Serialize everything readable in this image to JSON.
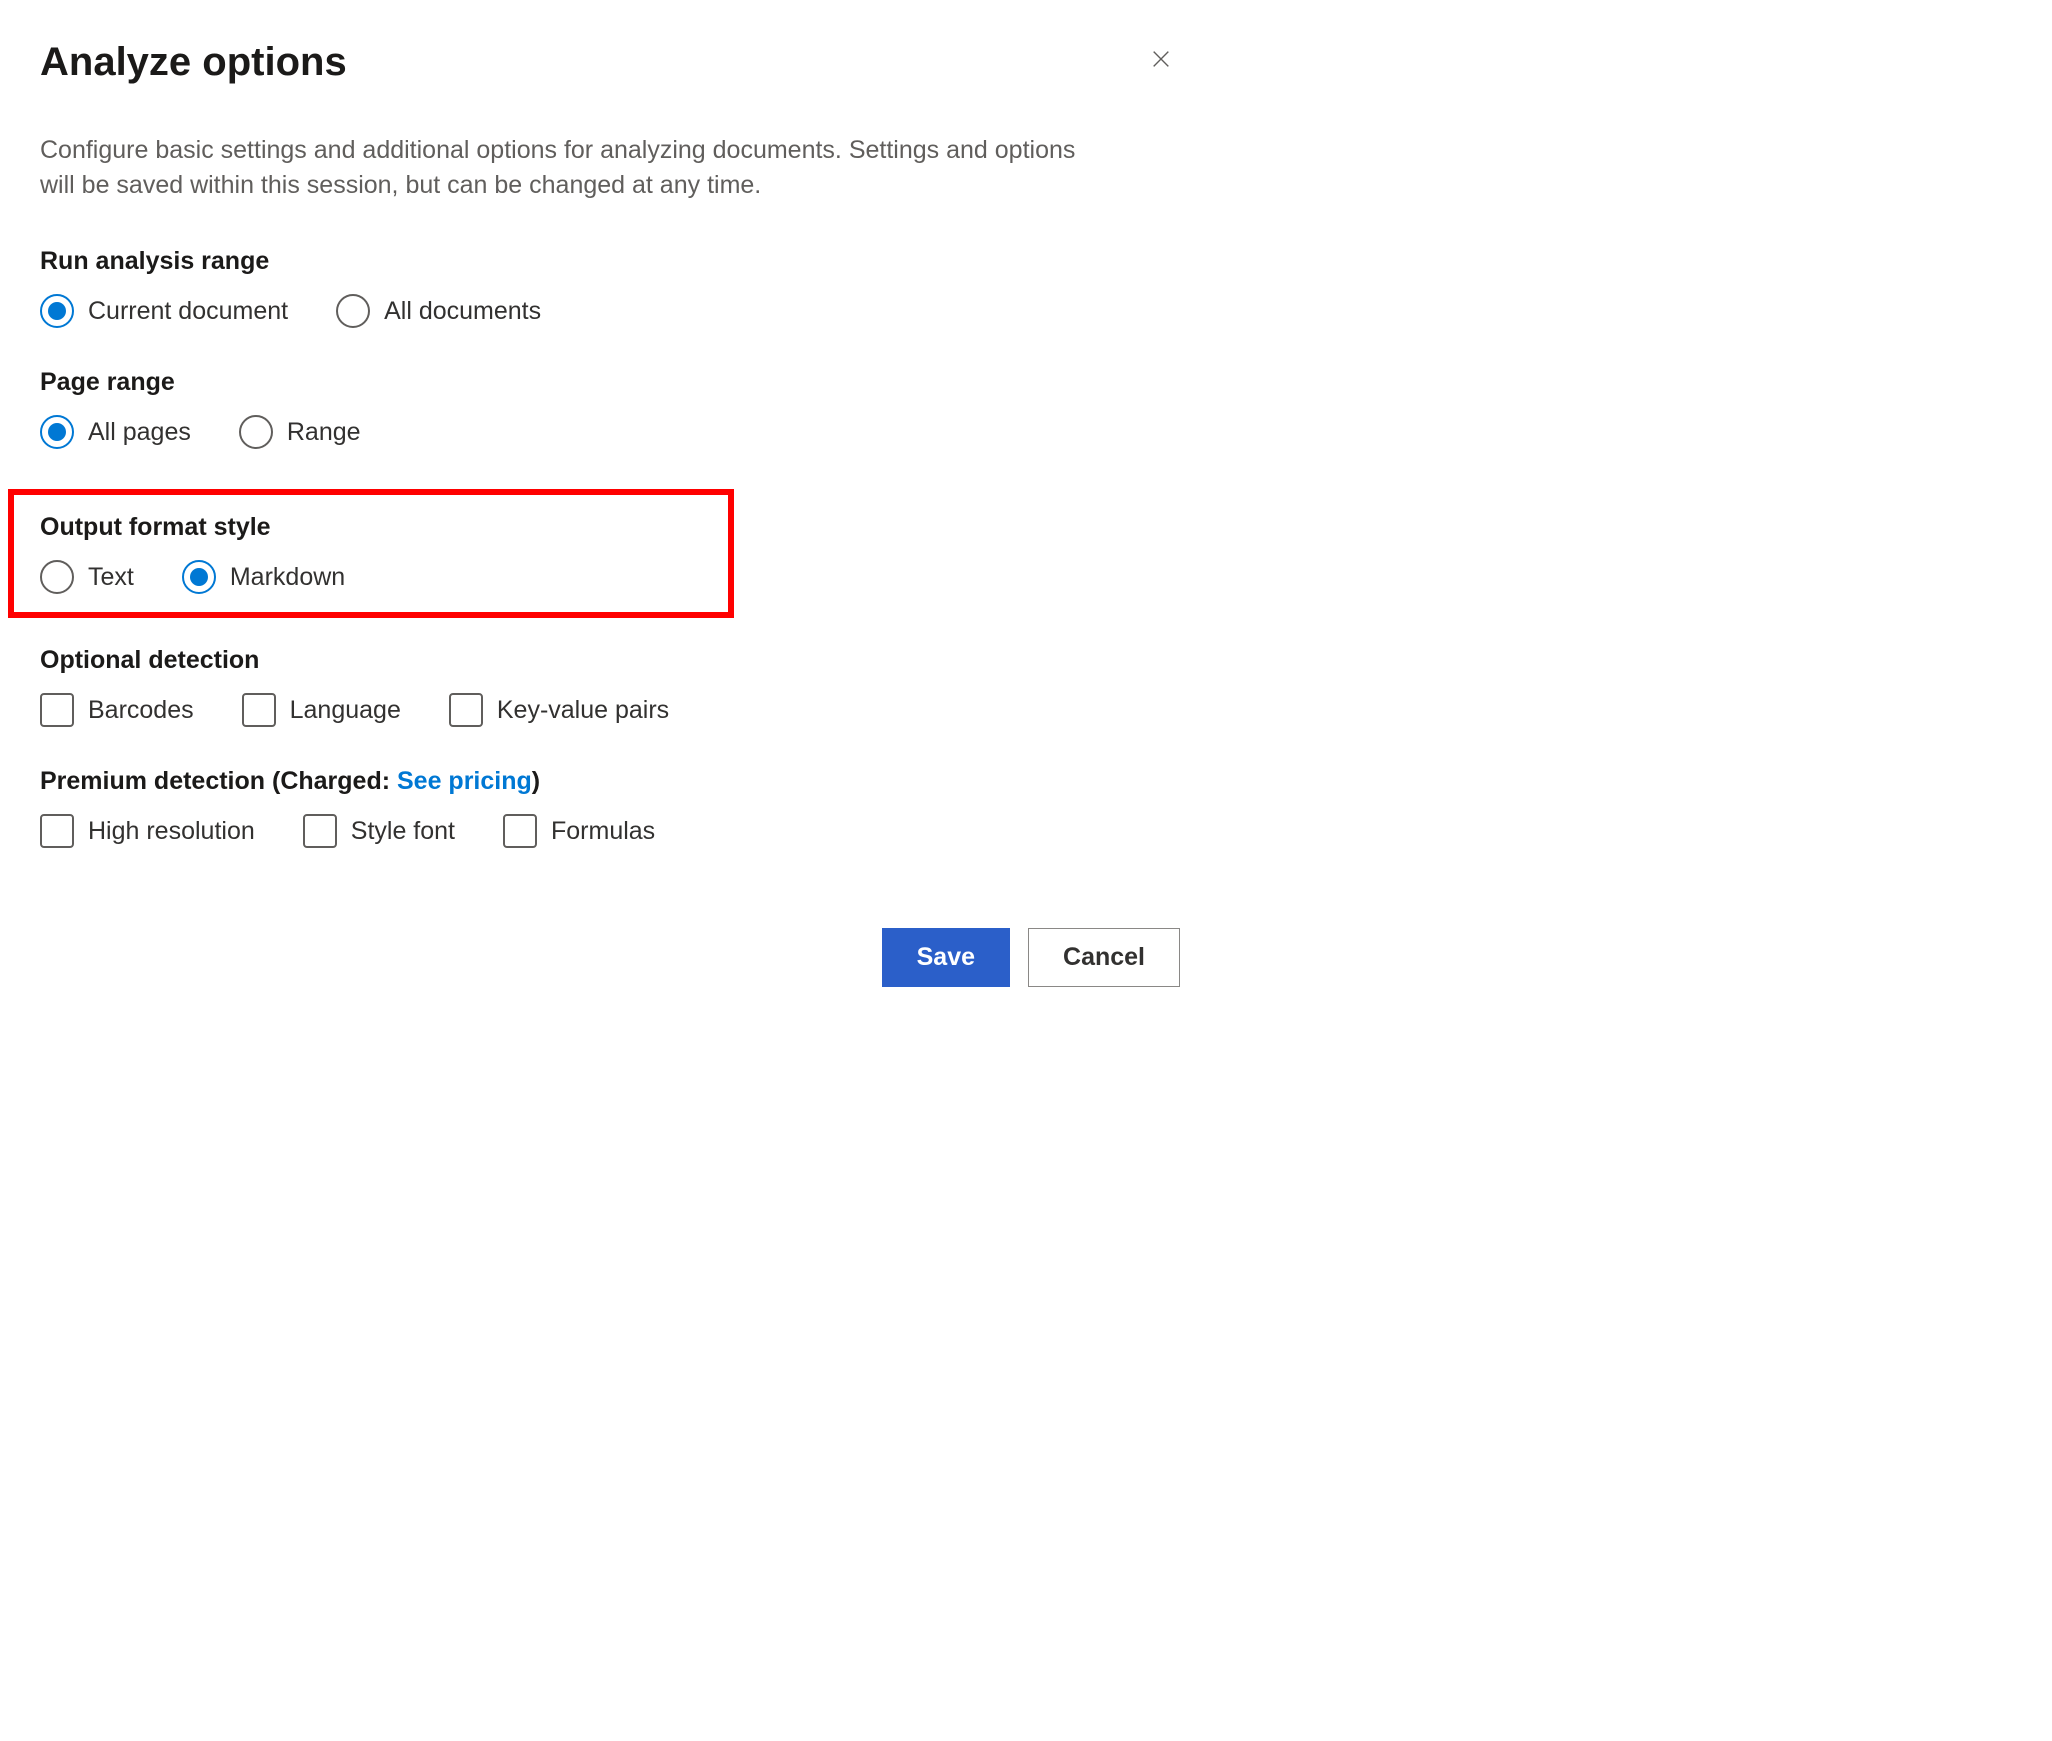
{
  "dialog": {
    "title": "Analyze options",
    "description": "Configure basic settings and additional options for analyzing documents. Settings and options will be saved within this session, but can be changed at any time."
  },
  "sections": {
    "runAnalysisRange": {
      "label": "Run analysis range",
      "options": {
        "current": "Current document",
        "all": "All documents"
      },
      "selected": "current"
    },
    "pageRange": {
      "label": "Page range",
      "options": {
        "all": "All pages",
        "range": "Range"
      },
      "selected": "all"
    },
    "outputFormat": {
      "label": "Output format style",
      "options": {
        "text": "Text",
        "markdown": "Markdown"
      },
      "selected": "markdown"
    },
    "optionalDetection": {
      "label": "Optional detection",
      "options": {
        "barcodes": "Barcodes",
        "language": "Language",
        "kvp": "Key-value pairs"
      }
    },
    "premiumDetection": {
      "label": "Premium detection (Charged: ",
      "pricingLink": "See pricing",
      "labelEnd": ")",
      "options": {
        "highRes": "High resolution",
        "styleFont": "Style font",
        "formulas": "Formulas"
      }
    }
  },
  "footer": {
    "save": "Save",
    "cancel": "Cancel"
  }
}
